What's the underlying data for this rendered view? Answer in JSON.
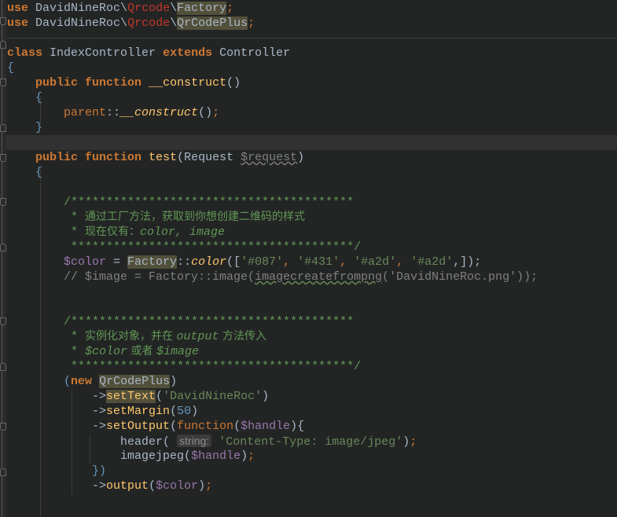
{
  "editor": {
    "language": "PHP",
    "lines": {
      "use1": {
        "kw": "use",
        "vendor": "DavidNineRoc\\",
        "ns": "Qrcode",
        "sep": "\\",
        "cls": "Factory",
        "end": ";"
      },
      "use2": {
        "kw": "use",
        "vendor": "DavidNineRoc\\",
        "ns": "Qrcode",
        "sep": "\\",
        "cls": "QrCodePlus",
        "end": ";"
      },
      "class_decl": {
        "kw_class": "class",
        "name": "IndexController",
        "kw_extends": "extends",
        "parent": "Controller"
      },
      "open_brace": "{",
      "ctor_decl": {
        "kw_public": "public",
        "kw_function": "function",
        "name": "__construct",
        "parens": "()"
      },
      "ctor_open": "{",
      "ctor_body": {
        "parent": "parent",
        "op": "::",
        "method": "__construct",
        "parens": "()",
        "end": ";"
      },
      "ctor_close": "}",
      "test_decl": {
        "kw_public": "public",
        "kw_function": "function",
        "name": "test",
        "open": "(",
        "type": "Request",
        "param": "$request",
        "close": ")"
      },
      "test_open": "{",
      "c1_top": "/****************************************",
      "c1_line1": {
        "star": " * ",
        "text": "通过工厂方法，获取到你想创建二维码的样式"
      },
      "c1_line2": {
        "star": " * ",
        "text": "现在仅有：",
        "tags": "color, image"
      },
      "c1_bottom": " ****************************************/",
      "color_assign": {
        "var": "$color",
        "eq": " = ",
        "cls": "Factory",
        "op": "::",
        "method": "color",
        "open": "([",
        "s1": "'#087'",
        "s2": "'#431'",
        "s3": "'#a2d'",
        "s4": "'#a2d'",
        "comma": ", ",
        "close": ",]);"
      },
      "image_comment": {
        "prefix": "// $image = Factory::image(",
        "fn": "imagecreatefrompng",
        "rest": "('DavidNineRoc.png'));"
      },
      "c2_top": "/****************************************",
      "c2_line1": {
        "star": " * ",
        "t1": "实例化对象，并在 ",
        "tag": "output",
        "t2": " 方法传入"
      },
      "c2_line2": {
        "star": " * ",
        "v1": "$color",
        "t1": " 或者 ",
        "v2": "$image"
      },
      "c2_bottom": " ****************************************/",
      "new_line": {
        "open": "(",
        "kw_new": "new",
        "cls": "QrCodePlus",
        "close": ")"
      },
      "set_text": {
        "arrow": "->",
        "method": "setText",
        "open": "(",
        "arg": "'DavidNineRoc'",
        "close": ")"
      },
      "set_margin": {
        "arrow": "->",
        "method": "setMargin",
        "open": "(",
        "arg": "50",
        "close": ")"
      },
      "set_output": {
        "arrow": "->",
        "method": "setOutput",
        "open": "(",
        "kw_function": "function",
        "p_open": "(",
        "param": "$handle",
        "p_close": "){"
      },
      "header_call": {
        "fn": "header",
        "open": "( ",
        "hint": "string:",
        "arg": " 'Content-Type: image/jpeg'",
        "close": ")",
        "end": ";"
      },
      "imagejpeg_call": {
        "fn": "imagejpeg",
        "open": "(",
        "arg": "$handle",
        "close": ")",
        "end": ";"
      },
      "closure_close": "})",
      "output_call": {
        "arrow": "->",
        "method": "output",
        "open": "(",
        "arg": "$color",
        "close": ")",
        "end": ";"
      }
    }
  }
}
